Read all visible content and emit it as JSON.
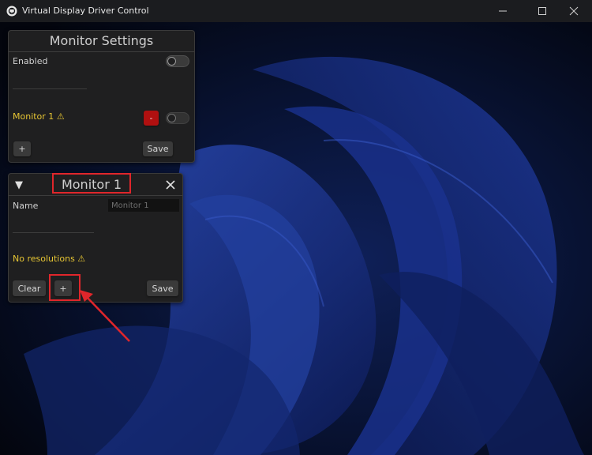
{
  "window": {
    "title": "Virtual Display Driver Control"
  },
  "monitor_settings": {
    "title": "Monitor Settings",
    "enabled_label": "Enabled",
    "monitor_label": "Monitor 1",
    "warning_glyph": "⚠",
    "remove_label": "-",
    "add_label": "+",
    "save_label": "Save"
  },
  "monitor_panel": {
    "collapse_glyph": "▼",
    "title": "Monitor 1",
    "close_glyph": "✕",
    "name_label": "Name",
    "name_placeholder": "Monitor 1",
    "no_resolutions_label": "No resolutions",
    "warning_glyph": "⚠",
    "clear_label": "Clear",
    "add_label": "+",
    "save_label": "Save"
  },
  "colors": {
    "warning_text": "#e6c533",
    "highlight": "#e0262b",
    "remove_button": "#b01010"
  }
}
